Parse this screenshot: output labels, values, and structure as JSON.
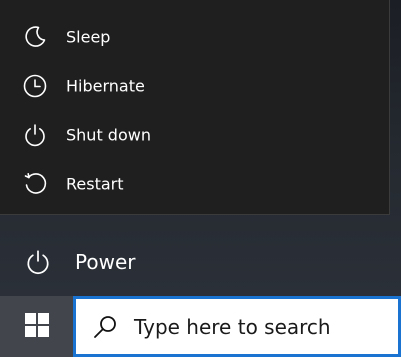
{
  "power_menu": {
    "items": [
      {
        "label": "Sleep",
        "icon": "moon-icon"
      },
      {
        "label": "Hibernate",
        "icon": "clock-icon"
      },
      {
        "label": "Shut down",
        "icon": "power-icon"
      },
      {
        "label": "Restart",
        "icon": "restart-icon"
      }
    ]
  },
  "start_menu": {
    "power_label": "Power",
    "power_icon": "power-icon"
  },
  "taskbar": {
    "start_icon": "windows-logo-icon",
    "search_placeholder": "Type here to search",
    "search_icon": "search-icon",
    "accent_color": "#1b73d1"
  }
}
